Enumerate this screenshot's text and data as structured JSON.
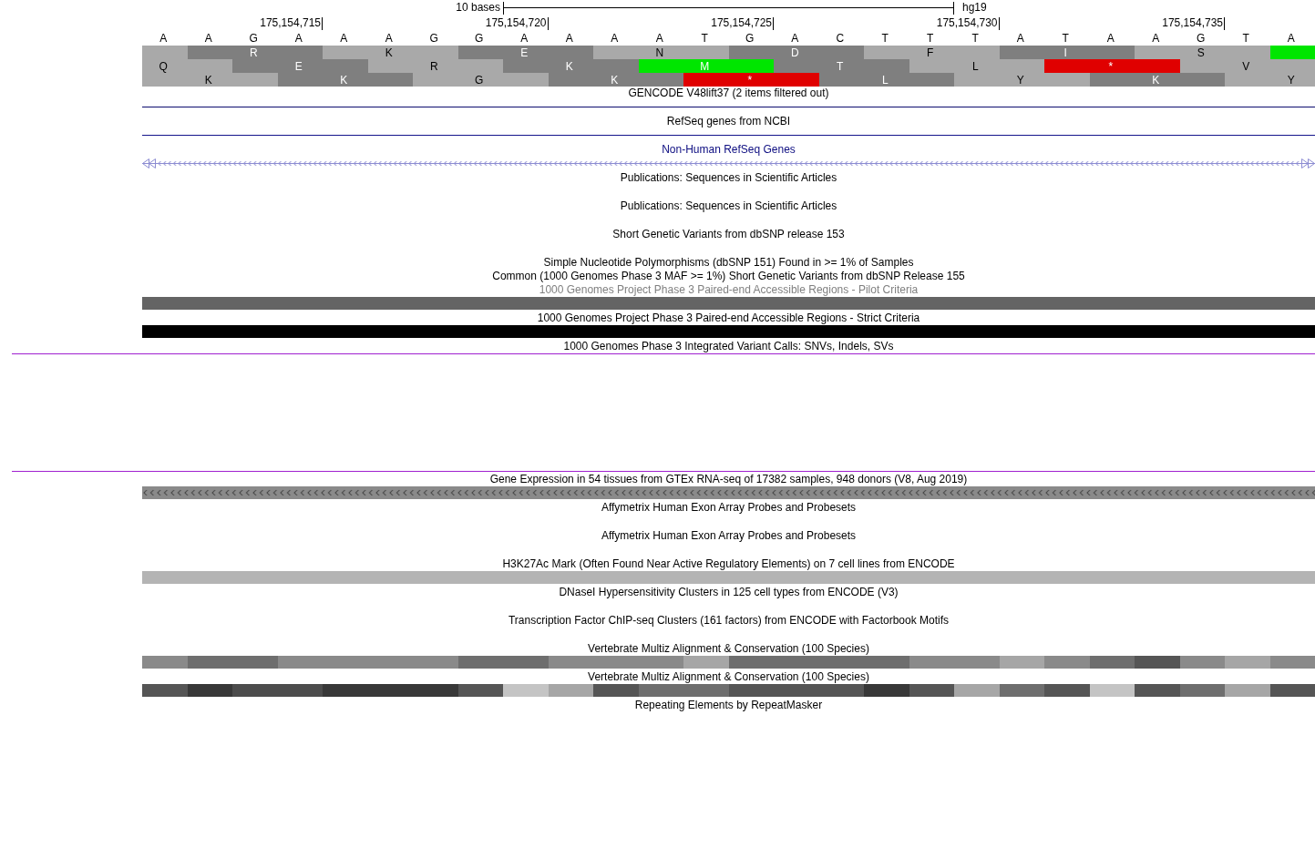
{
  "ruler": {
    "scale_label": "10 bases",
    "assembly": "hg19"
  },
  "bases": [
    {
      "letter": "A"
    },
    {
      "letter": "A"
    },
    {
      "letter": "G"
    },
    {
      "letter": "A",
      "position_label": "175,154,715"
    },
    {
      "letter": "A"
    },
    {
      "letter": "A"
    },
    {
      "letter": "G"
    },
    {
      "letter": "G"
    },
    {
      "letter": "A",
      "position_label": "175,154,720"
    },
    {
      "letter": "A"
    },
    {
      "letter": "A"
    },
    {
      "letter": "A"
    },
    {
      "letter": "T"
    },
    {
      "letter": "G",
      "position_label": "175,154,725"
    },
    {
      "letter": "A"
    },
    {
      "letter": "C"
    },
    {
      "letter": "T"
    },
    {
      "letter": "T"
    },
    {
      "letter": "T",
      "position_label": "175,154,730"
    },
    {
      "letter": "A"
    },
    {
      "letter": "T"
    },
    {
      "letter": "A"
    },
    {
      "letter": "A"
    },
    {
      "letter": "G",
      "position_label": "175,154,735"
    },
    {
      "letter": "T"
    },
    {
      "letter": "A"
    }
  ],
  "frames": [
    {
      "codons": [
        {
          "kind": "light",
          "partial": true
        },
        {
          "kind": "dark",
          "amino_acid": "R",
          "partial": false
        },
        {
          "kind": "light",
          "amino_acid": "K",
          "partial": false
        },
        {
          "kind": "dark",
          "amino_acid": "E",
          "partial": false
        },
        {
          "kind": "light",
          "amino_acid": "N",
          "partial": false
        },
        {
          "kind": "dark",
          "amino_acid": "D",
          "partial": false
        },
        {
          "kind": "light",
          "amino_acid": "F",
          "partial": false
        },
        {
          "kind": "dark",
          "amino_acid": "I",
          "partial": false
        },
        {
          "kind": "light",
          "amino_acid": "S",
          "partial": false
        },
        {
          "kind": "start",
          "partial": true
        }
      ]
    },
    {
      "codons": [
        {
          "kind": "light",
          "amino_acid": "Q",
          "partial": true
        },
        {
          "kind": "dark",
          "amino_acid": "E",
          "partial": false
        },
        {
          "kind": "light",
          "amino_acid": "R",
          "partial": false
        },
        {
          "kind": "dark",
          "amino_acid": "K",
          "partial": false
        },
        {
          "kind": "start",
          "amino_acid": "M",
          "partial": false
        },
        {
          "kind": "dark",
          "amino_acid": "T",
          "partial": false
        },
        {
          "kind": "light",
          "amino_acid": "L",
          "partial": false
        },
        {
          "kind": "stop",
          "amino_acid": "*",
          "partial": false
        },
        {
          "kind": "light",
          "amino_acid": "V",
          "partial": false
        }
      ]
    },
    {
      "codons": [
        {
          "kind": "light",
          "amino_acid": "K",
          "partial": false
        },
        {
          "kind": "dark",
          "amino_acid": "K",
          "partial": false
        },
        {
          "kind": "light",
          "amino_acid": "G",
          "partial": false
        },
        {
          "kind": "dark",
          "amino_acid": "K",
          "partial": false
        },
        {
          "kind": "stop",
          "amino_acid": "*",
          "partial": false
        },
        {
          "kind": "dark",
          "amino_acid": "L",
          "partial": false
        },
        {
          "kind": "light",
          "amino_acid": "Y",
          "partial": false
        },
        {
          "kind": "dark",
          "amino_acid": "K",
          "partial": false
        },
        {
          "kind": "light",
          "amino_acid": "Y",
          "partial": true
        }
      ]
    }
  ],
  "tracks": [
    {
      "label": {
        "text": "GENCODE V48lift37 (2 items filtered out)",
        "color": "#000000"
      },
      "body": {
        "kind": "line",
        "color": "#0c0c6e"
      }
    },
    {
      "label": {
        "text": "RefSeq genes from NCBI",
        "color": "#000000"
      },
      "body": {
        "kind": "line",
        "color": "#14148c"
      }
    },
    {
      "label": {
        "text": "Non-Human RefSeq Genes",
        "color": "#0c0c80"
      },
      "body": {
        "kind": "strand-line",
        "color": "#8c8cd2"
      }
    },
    {
      "label": {
        "text": "Publications: Sequences in Scientific Articles",
        "color": "#000000"
      },
      "body": {
        "kind": "empty"
      }
    },
    {
      "label": {
        "text": "Publications: Sequences in Scientific Articles",
        "color": "#000000"
      },
      "body": {
        "kind": "empty"
      }
    },
    {
      "label": {
        "text": "Short Genetic Variants from dbSNP release 153",
        "color": "#000000"
      },
      "body": {
        "kind": "empty"
      }
    },
    {
      "label": {
        "text": "Simple Nucleotide Polymorphisms (dbSNP 151) Found in >= 1% of Samples",
        "color": "#000000"
      }
    },
    {
      "label": {
        "text": "Common (1000 Genomes Phase 3 MAF >= 1%) Short Genetic Variants from dbSNP Release 155",
        "color": "#000000"
      }
    },
    {
      "label": {
        "text": "1000 Genomes Project Phase 3 Paired-end Accessible Regions - Pilot Criteria",
        "color": "#808080"
      },
      "body": {
        "kind": "bar",
        "color": "#646464"
      }
    },
    {
      "label": {
        "text": "1000 Genomes Project Phase 3 Paired-end Accessible Regions - Strict Criteria",
        "color": "#000000"
      },
      "body": {
        "kind": "bar",
        "color": "#000000"
      }
    },
    {
      "label": {
        "text": "1000 Genomes Phase 3 Integrated Variant Calls: SNVs, Indels, SVs",
        "color": "#000000"
      },
      "body": {
        "kind": "panel",
        "color": "#a020d0"
      }
    },
    {
      "label": {
        "text": "Gene Expression in 54 tissues from GTEx RNA-seq of 17382 samples, 948 donors (V8, Aug 2019)",
        "color": "#000000"
      },
      "body": {
        "kind": "chevron-bar",
        "color": "#8a8a8a"
      }
    },
    {
      "label": {
        "text": "Affymetrix Human Exon Array Probes and Probesets",
        "color": "#000000"
      },
      "body": {
        "kind": "empty"
      }
    },
    {
      "label": {
        "text": "Affymetrix Human Exon Array Probes and Probesets",
        "color": "#000000"
      },
      "body": {
        "kind": "empty"
      }
    },
    {
      "label": {
        "text": "H3K27Ac Mark (Often Found Near Active Regulatory Elements) on 7 cell lines from ENCODE",
        "color": "#000000"
      },
      "body": {
        "kind": "bar",
        "color": "#b4b4b4"
      }
    },
    {
      "label": {
        "text": "DNaseI Hypersensitivity Clusters in 125 cell types from ENCODE (V3)",
        "color": "#000000"
      },
      "body": {
        "kind": "empty"
      }
    },
    {
      "label": {
        "text": "Transcription Factor ChIP-seq Clusters (161 factors) from ENCODE with Factorbook Motifs",
        "color": "#000000"
      },
      "body": {
        "kind": "empty"
      }
    },
    {
      "label": {
        "text": "Vertebrate Multiz Alignment & Conservation (100 Species)",
        "color": "#000000"
      },
      "body": {
        "kind": "heatmap",
        "cells": [
          {
            "color": "#8a8a8a"
          },
          {
            "color": "#6e6e6e"
          },
          {
            "color": "#6e6e6e"
          },
          {
            "color": "#8a8a8a"
          },
          {
            "color": "#8a8a8a"
          },
          {
            "color": "#8a8a8a"
          },
          {
            "color": "#8a8a8a"
          },
          {
            "color": "#6e6e6e"
          },
          {
            "color": "#6e6e6e"
          },
          {
            "color": "#8a8a8a"
          },
          {
            "color": "#8a8a8a"
          },
          {
            "color": "#8a8a8a"
          },
          {
            "color": "#a6a6a6"
          },
          {
            "color": "#6e6e6e"
          },
          {
            "color": "#6e6e6e"
          },
          {
            "color": "#6e6e6e"
          },
          {
            "color": "#6e6e6e"
          },
          {
            "color": "#8a8a8a"
          },
          {
            "color": "#8a8a8a"
          },
          {
            "color": "#a6a6a6"
          },
          {
            "color": "#8a8a8a"
          },
          {
            "color": "#6e6e6e"
          },
          {
            "color": "#555555"
          },
          {
            "color": "#8a8a8a"
          },
          {
            "color": "#a6a6a6"
          },
          {
            "color": "#8a8a8a"
          }
        ]
      }
    },
    {
      "label": {
        "text": "Vertebrate Multiz Alignment & Conservation (100 Species)",
        "color": "#000000"
      },
      "body": {
        "kind": "heatmap",
        "cells": [
          {
            "color": "#555555"
          },
          {
            "color": "#383838"
          },
          {
            "color": "#4c4c4c"
          },
          {
            "color": "#4c4c4c"
          },
          {
            "color": "#383838"
          },
          {
            "color": "#383838"
          },
          {
            "color": "#383838"
          },
          {
            "color": "#555555"
          },
          {
            "color": "#c4c4c4"
          },
          {
            "color": "#a6a6a6"
          },
          {
            "color": "#555555"
          },
          {
            "color": "#6e6e6e"
          },
          {
            "color": "#6e6e6e"
          },
          {
            "color": "#555555"
          },
          {
            "color": "#555555"
          },
          {
            "color": "#555555"
          },
          {
            "color": "#383838"
          },
          {
            "color": "#555555"
          },
          {
            "color": "#a6a6a6"
          },
          {
            "color": "#6e6e6e"
          },
          {
            "color": "#555555"
          },
          {
            "color": "#c4c4c4"
          },
          {
            "color": "#555555"
          },
          {
            "color": "#6e6e6e"
          },
          {
            "color": "#a6a6a6"
          },
          {
            "color": "#555555"
          }
        ]
      }
    },
    {
      "label": {
        "text": "Repeating Elements by RepeatMasker",
        "color": "#000000"
      },
      "body": {
        "kind": "empty"
      }
    }
  ]
}
